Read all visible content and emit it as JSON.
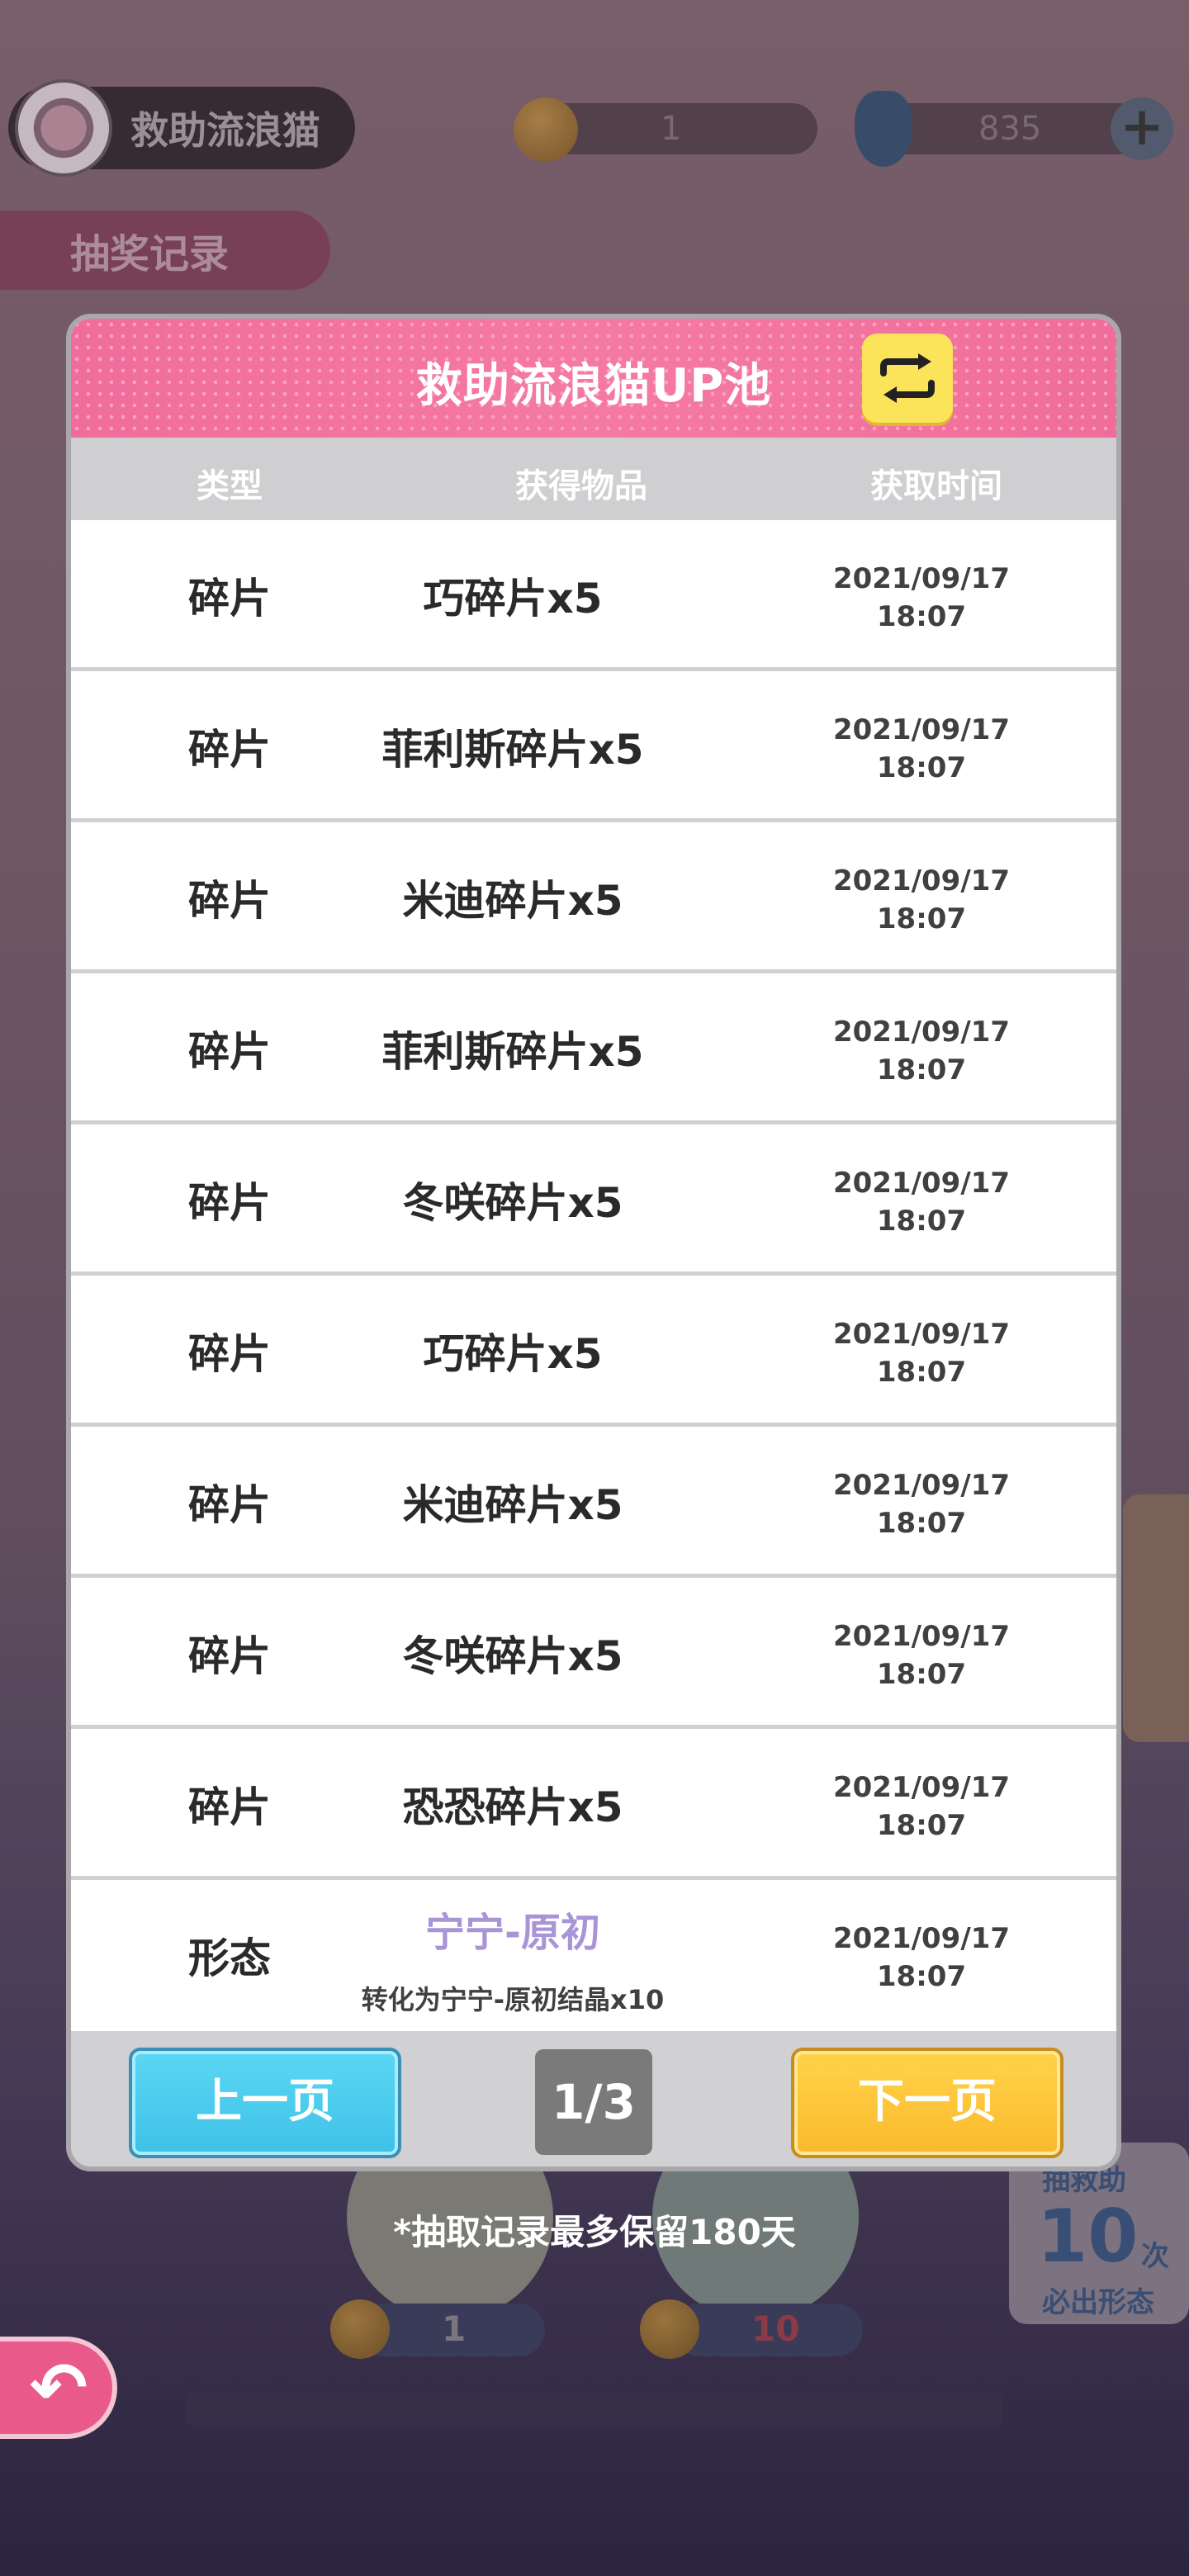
{
  "header": {
    "event_name": "救助流浪猫",
    "coins": "1",
    "gems": "835",
    "tab_label": "抽奖记录"
  },
  "modal": {
    "title": "救助流浪猫UP池",
    "columns": [
      "类型",
      "获得物品",
      "获取时间"
    ],
    "rows": [
      {
        "type": "碎片",
        "item": "巧碎片x5",
        "date": "2021/09/17",
        "time": "18:07"
      },
      {
        "type": "碎片",
        "item": "菲利斯碎片x5",
        "date": "2021/09/17",
        "time": "18:07"
      },
      {
        "type": "碎片",
        "item": "米迪碎片x5",
        "date": "2021/09/17",
        "time": "18:07"
      },
      {
        "type": "碎片",
        "item": "菲利斯碎片x5",
        "date": "2021/09/17",
        "time": "18:07"
      },
      {
        "type": "碎片",
        "item": "冬咲碎片x5",
        "date": "2021/09/17",
        "time": "18:07"
      },
      {
        "type": "碎片",
        "item": "巧碎片x5",
        "date": "2021/09/17",
        "time": "18:07"
      },
      {
        "type": "碎片",
        "item": "米迪碎片x5",
        "date": "2021/09/17",
        "time": "18:07"
      },
      {
        "type": "碎片",
        "item": "冬咲碎片x5",
        "date": "2021/09/17",
        "time": "18:07"
      },
      {
        "type": "碎片",
        "item": "恐恐碎片x5",
        "date": "2021/09/17",
        "time": "18:07"
      }
    ],
    "last_row": {
      "type": "形态",
      "item": "宁宁-原初",
      "note": "转化为宁宁-原初结晶x10",
      "date": "2021/09/17",
      "time": "18:07"
    },
    "prev_label": "上一页",
    "next_label": "下一页",
    "page": "1/3"
  },
  "footnote": "*抽取记录最多保留180天",
  "background": {
    "pity_top": "抽救助",
    "pity_count": "10",
    "pity_unit": "次",
    "pity_bottom": "必出形态",
    "cost_single": "1",
    "cost_ten": "10"
  },
  "colors": {
    "header_pink": "#f06d9a",
    "prev_blue": "#3ec1e8",
    "next_yellow": "#fbb92c",
    "form_item_purple": "#a895d6"
  }
}
